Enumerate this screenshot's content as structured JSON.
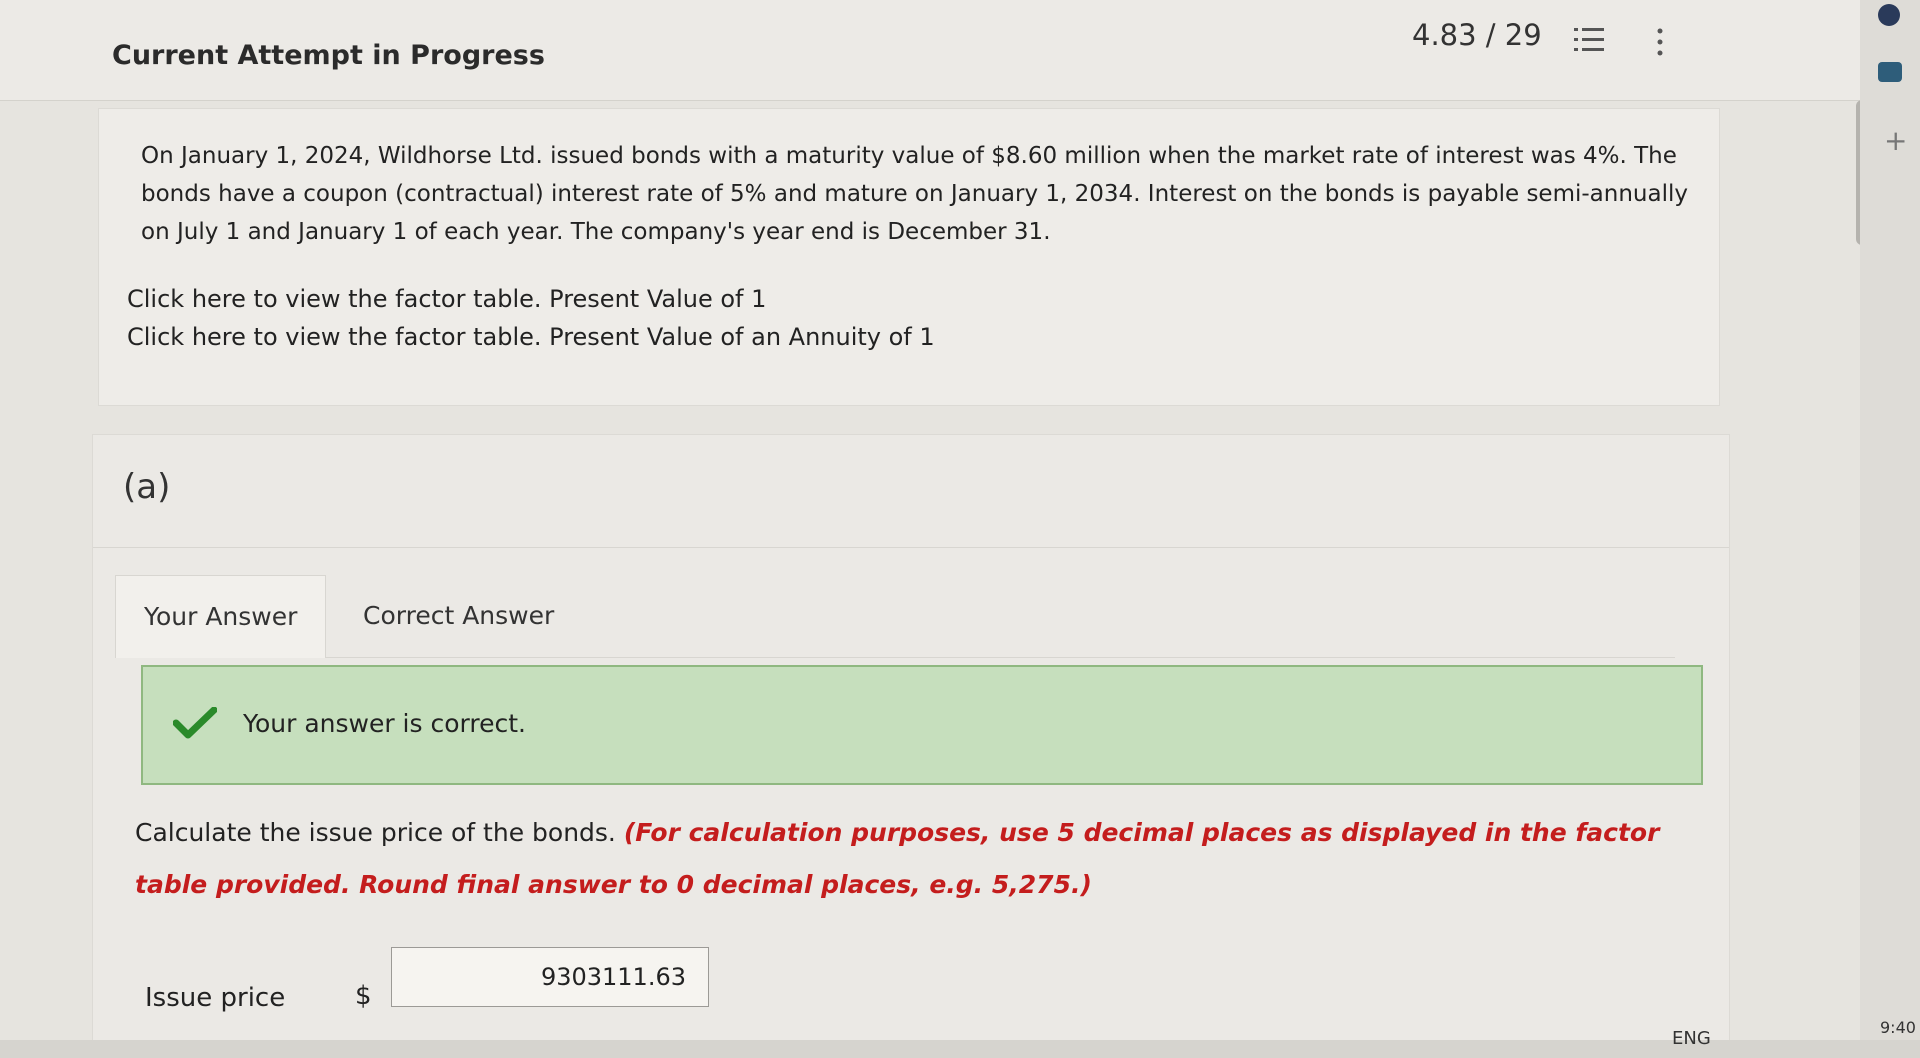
{
  "header": {
    "title": "Current Attempt in Progress",
    "score": "4.83 / 29"
  },
  "question": {
    "text": "On January 1, 2024, Wildhorse Ltd. issued bonds with a maturity value of $8.60 million when the market rate of interest was 4%. The bonds have a coupon (contractual) interest rate of 5% and mature on January 1, 2034. Interest on the bonds is payable semi-annually on July 1 and January 1 of each year. The company's year end is December 31.",
    "link_pv": "Click here to view the factor table. Present Value of 1",
    "link_pva": "Click here to view the factor table. Present Value of an Annuity of 1"
  },
  "part": {
    "label": "(a)",
    "tabs": [
      "Your Answer",
      "Correct Answer"
    ],
    "feedback": "Your answer is correct.",
    "instruction_plain": "Calculate the issue price of the bonds. ",
    "instruction_red": "(For calculation purposes, use 5 decimal places as displayed in the factor table provided. Round final answer to 0 decimal places, e.g. 5,275.)",
    "issue_label": "Issue price",
    "currency": "$",
    "issue_value": "9303111.63"
  },
  "taskbar": {
    "language": "ENG",
    "time": "9:40"
  },
  "colors": {
    "success_bg": "#c6dfbd",
    "success_check": "#2a8a2a",
    "instruction_red": "#c41d1d"
  }
}
